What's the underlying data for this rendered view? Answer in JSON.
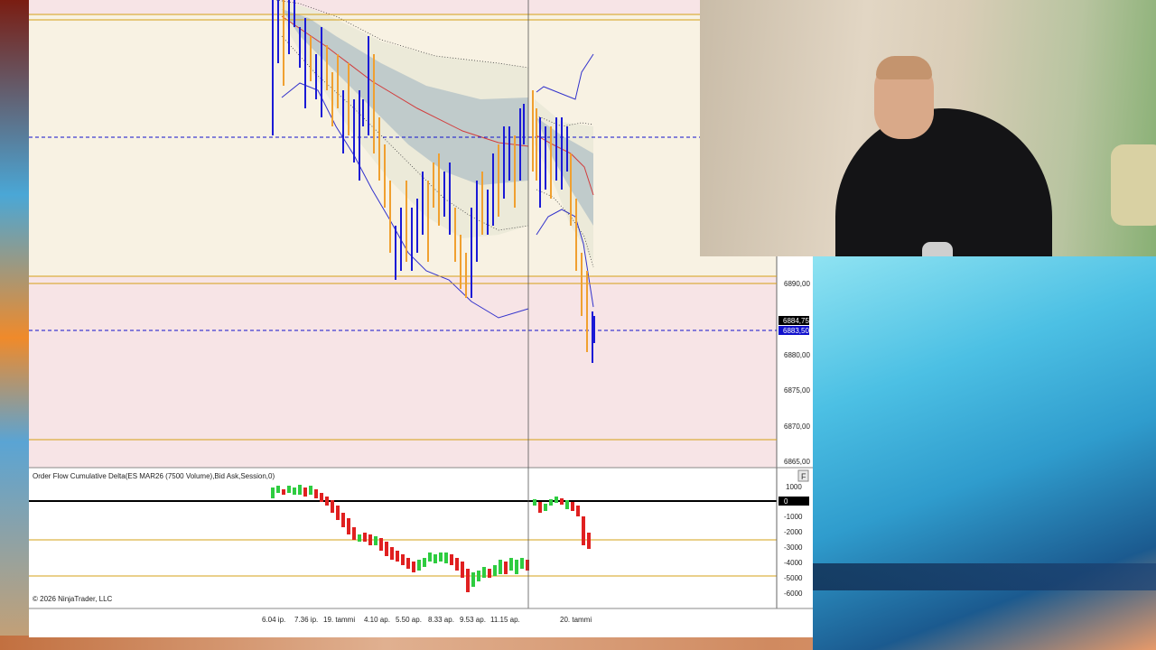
{
  "indicator": {
    "title": "Order Flow Cumulative Delta(ES MAR26 (7500 Volume),Bid Ask,Session,0)",
    "panel_button": "F"
  },
  "copyright": "© 2026 NinjaTrader, LLC",
  "price_axis": {
    "tick_labels": [
      "6890,00",
      "6880,00",
      "6875,00",
      "6870,00",
      "6865,00"
    ],
    "last_price_label": "6884,75",
    "bid_price_label": "6883,50"
  },
  "delta_axis": {
    "tick_labels": [
      "1000",
      "-1000",
      "-2000",
      "-3000",
      "-4000",
      "-5000",
      "-6000"
    ],
    "zero_label": "0"
  },
  "time_axis": {
    "tick_labels": [
      "6.04 ip.",
      "7.36 ip.",
      "19. tammi",
      "4.10 ap.",
      "5.50 ap.",
      "8.33 ap.",
      "9.53 ap.",
      "11.15 ap.",
      "20. tammi"
    ]
  },
  "colors": {
    "up_bar": "#f0a030",
    "down_bar": "#1a1ad6",
    "delta_up": "#2ecc40",
    "delta_down": "#e02020",
    "level_line": "#d4a017",
    "dashed_level": "#1010cc",
    "band_zone": "#f8f2e3",
    "pink_zone": "#f7e4e6"
  }
}
